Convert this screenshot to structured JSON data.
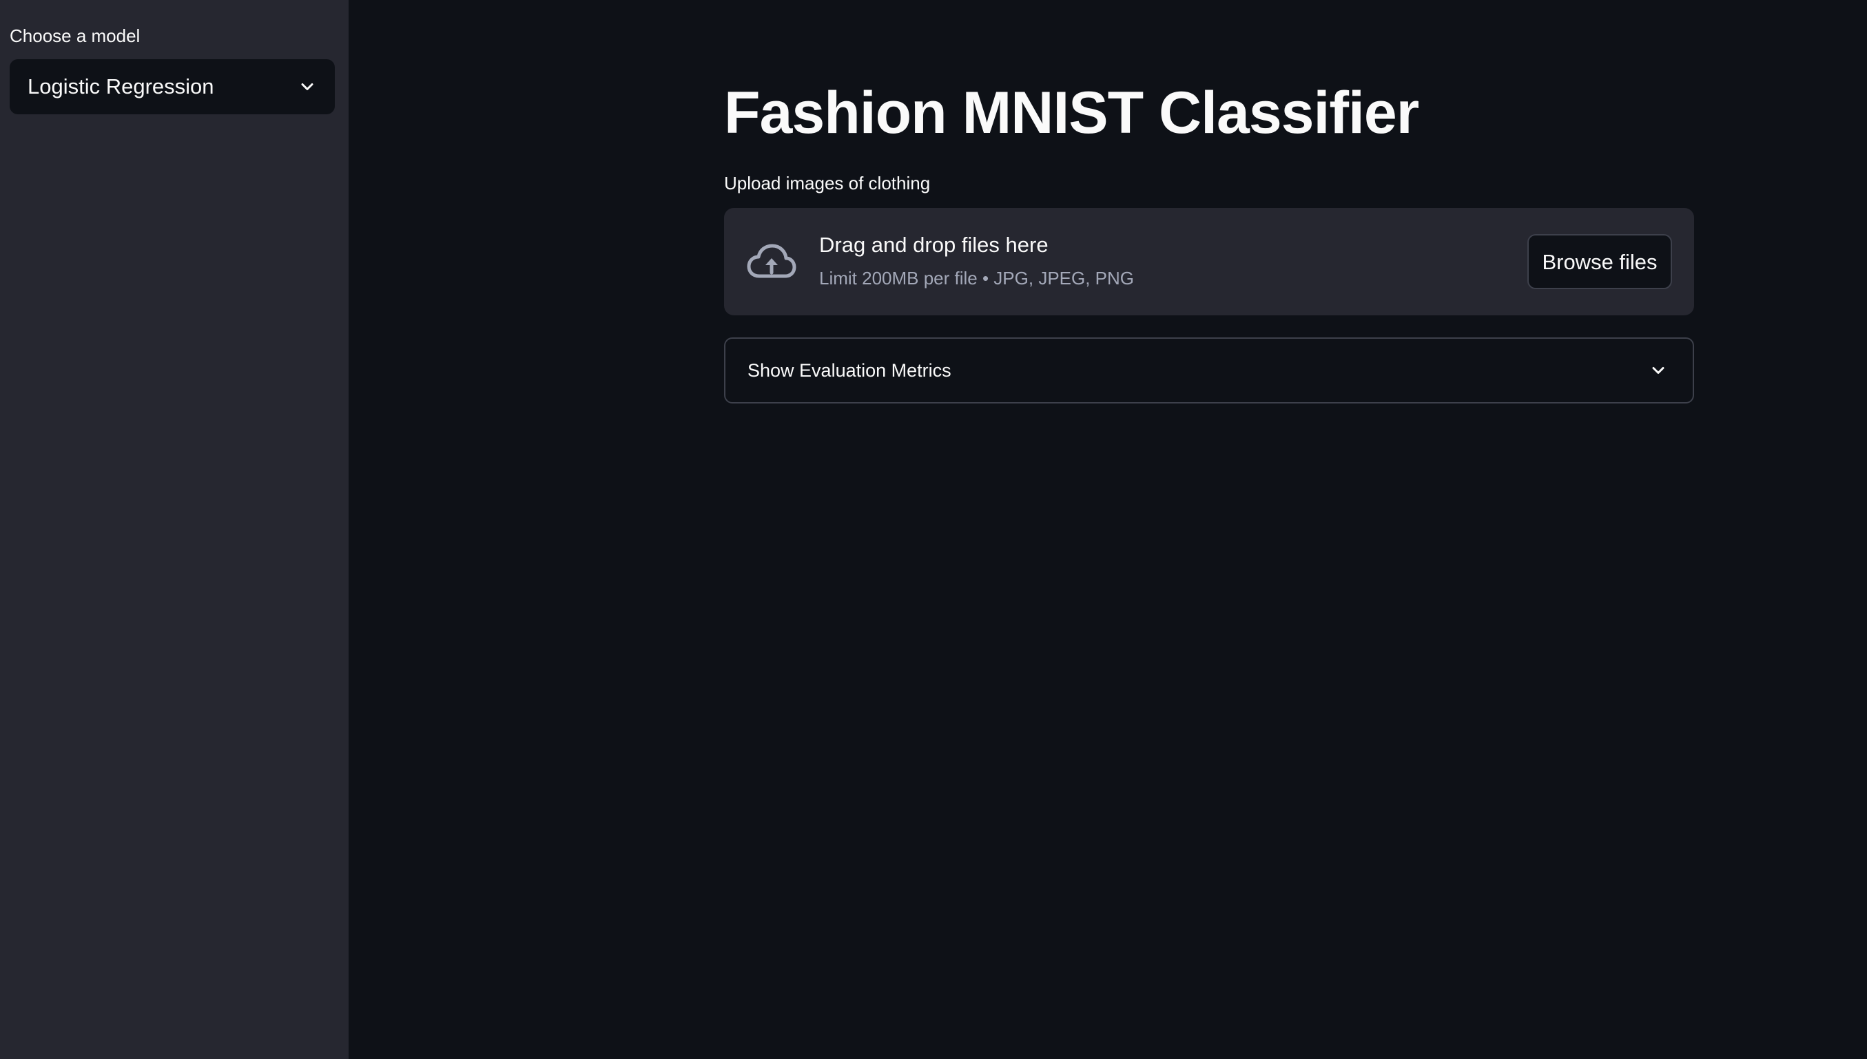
{
  "sidebar": {
    "model_label": "Choose a model",
    "model_selected": "Logistic Regression"
  },
  "main": {
    "title": "Fashion MNIST Classifier",
    "uploader": {
      "label": "Upload images of clothing",
      "drop_text": "Drag and drop files here",
      "limit_text": "Limit 200MB per file • JPG, JPEG, PNG",
      "browse_label": "Browse files"
    },
    "expander": {
      "label": "Show Evaluation Metrics"
    }
  },
  "icons": {
    "select_chevron": "chevron-down-icon",
    "upload": "cloud-upload-icon",
    "expander_chevron": "chevron-down-icon"
  },
  "colors": {
    "background": "#0e1117",
    "sidebar": "#262730",
    "dropzone": "#262730",
    "text": "#fafafa",
    "muted_text": "#a3a8b8",
    "border": "#3d404b"
  }
}
